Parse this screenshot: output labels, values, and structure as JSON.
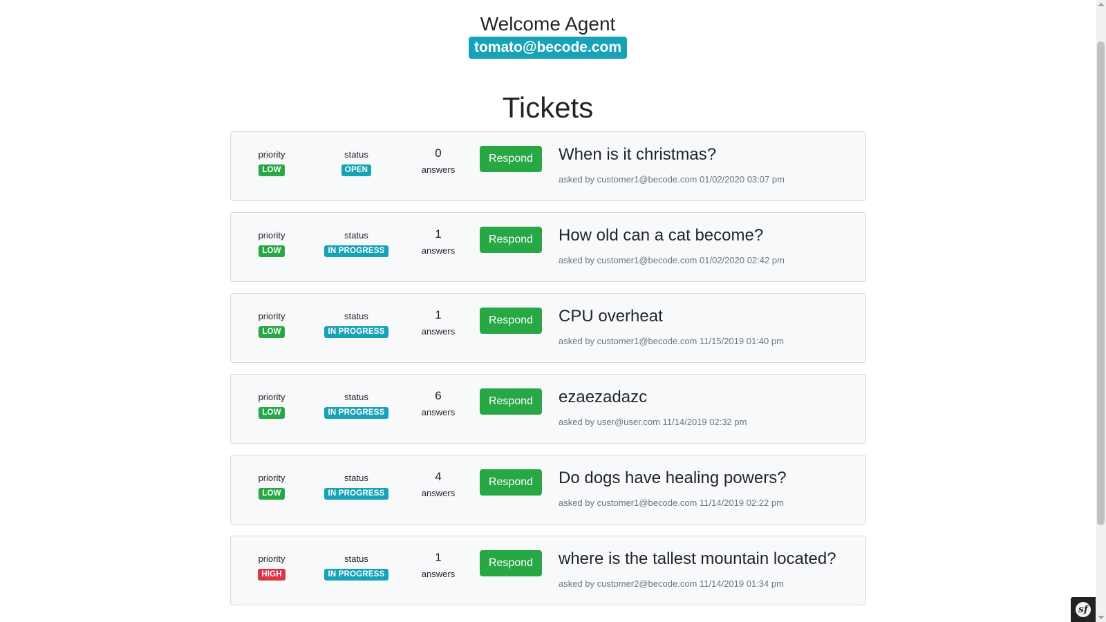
{
  "header": {
    "welcome": "Welcome Agent",
    "email": "tomato@becode.com"
  },
  "section_title": "Tickets",
  "labels": {
    "priority": "priority",
    "status": "status",
    "answers": "answers",
    "respond": "Respond",
    "asked_by": "asked by"
  },
  "tickets": [
    {
      "priority": "LOW",
      "status": "OPEN",
      "answers": "0",
      "title": "When is it christmas?",
      "author": "customer1@becode.com",
      "date": "01/02/2020 03:07 pm"
    },
    {
      "priority": "LOW",
      "status": "IN PROGRESS",
      "answers": "1",
      "title": "How old can a cat become?",
      "author": "customer1@becode.com",
      "date": "01/02/2020 02:42 pm"
    },
    {
      "priority": "LOW",
      "status": "IN PROGRESS",
      "answers": "1",
      "title": "CPU overheat",
      "author": "customer1@becode.com",
      "date": "11/15/2019 01:40 pm"
    },
    {
      "priority": "LOW",
      "status": "IN PROGRESS",
      "answers": "6",
      "title": "ezaezadazc",
      "author": "user@user.com",
      "date": "11/14/2019 02:32 pm"
    },
    {
      "priority": "LOW",
      "status": "IN PROGRESS",
      "answers": "4",
      "title": "Do dogs have healing powers?",
      "author": "customer1@becode.com",
      "date": "11/14/2019 02:22 pm"
    },
    {
      "priority": "HIGH",
      "status": "IN PROGRESS",
      "answers": "1",
      "title": "where is the tallest mountain located?",
      "author": "customer2@becode.com",
      "date": "11/14/2019 01:34 pm"
    }
  ],
  "colors": {
    "success": "#28a745",
    "danger": "#dc3545",
    "info": "#17a2b8",
    "muted": "#6c757d",
    "card_bg": "#f8f9fa"
  },
  "icons": {
    "debug_toolbar": "symfony-logo-icon"
  }
}
